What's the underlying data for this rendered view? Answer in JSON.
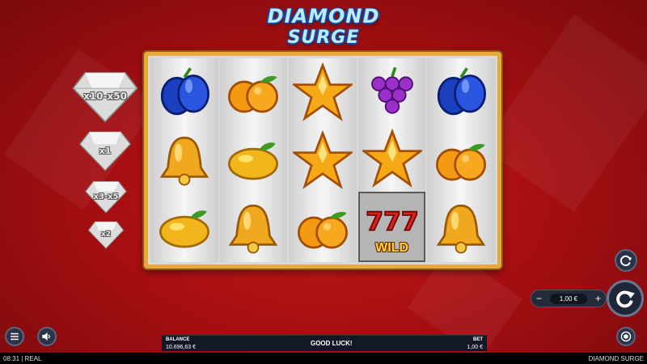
{
  "logo": {
    "line1": "DIAMOND",
    "line2": "SURGE"
  },
  "multipliers": [
    {
      "label": "x10-x50"
    },
    {
      "label": "x1"
    },
    {
      "label": "x3-x5"
    },
    {
      "label": "x2"
    }
  ],
  "reels": [
    [
      "plum-icon",
      "bell-icon",
      "lemon-icon"
    ],
    [
      "orange-icon",
      "lemon-icon",
      "bell-icon"
    ],
    [
      "star-icon",
      "star-icon",
      "orange-icon"
    ],
    [
      "grape-icon",
      "star-icon",
      "wild-icon"
    ],
    [
      "plum-icon",
      "orange-icon",
      "bell-icon"
    ]
  ],
  "wild_label": "WILD",
  "bet_control": {
    "minus": "−",
    "plus": "+",
    "amount": "1,00 €"
  },
  "status_bar": {
    "balance_label": "BALANCE",
    "balance_value": "10.696,63 €",
    "message": "GOOD LUCK!",
    "bet_label": "BET",
    "bet_value": "1,00 €"
  },
  "footer": {
    "left": "08:31  |  REAL",
    "right": "DIAMOND SURGE"
  },
  "colors": {
    "background": "#a80f12",
    "frame": "#e7a93b",
    "control_bg": "#2b3347"
  }
}
